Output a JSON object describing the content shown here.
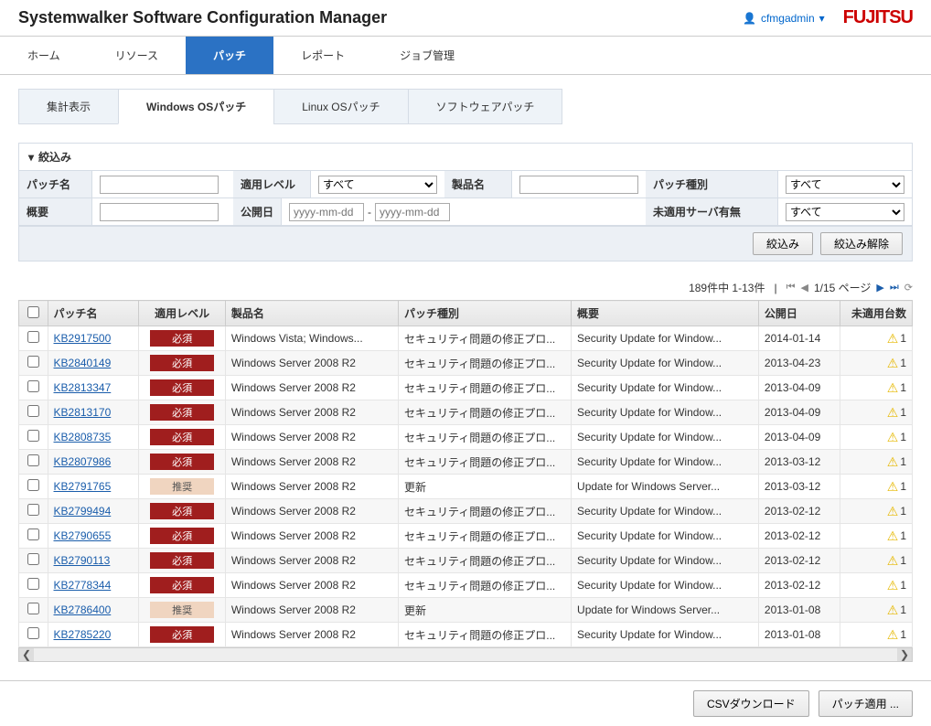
{
  "header": {
    "title": "Systemwalker Software Configuration Manager",
    "username": "cfmgadmin",
    "logo": "FUJITSU"
  },
  "main_nav": {
    "items": [
      "ホーム",
      "リソース",
      "パッチ",
      "レポート",
      "ジョブ管理"
    ],
    "active": 2
  },
  "sub_tabs": {
    "items": [
      "集計表示",
      "Windows OSパッチ",
      "Linux OSパッチ",
      "ソフトウェアパッチ"
    ],
    "active": 1
  },
  "filter": {
    "title": "絞込み",
    "labels": {
      "patch_name": "パッチ名",
      "apply_level": "適用レベル",
      "product_name": "製品名",
      "patch_type": "パッチ種別",
      "summary": "概要",
      "publish_date": "公開日",
      "unapplied_server": "未適用サーバ有無"
    },
    "placeholders": {
      "date": "yyyy-mm-dd"
    },
    "select_all": "すべて",
    "date_sep": "-",
    "actions": {
      "filter": "絞込み",
      "clear": "絞込み解除"
    }
  },
  "pagination": {
    "count_text": "189件中 1-13件",
    "page_text": "1/15 ページ"
  },
  "table": {
    "headers": {
      "name": "パッチ名",
      "level": "適用レベル",
      "product": "製品名",
      "type": "パッチ種別",
      "summary": "概要",
      "date": "公開日",
      "unapplied": "未適用台数"
    },
    "level_labels": {
      "required": "必須",
      "recommended": "推奨"
    },
    "rows": [
      {
        "name": "KB2917500",
        "level": "required",
        "product": "Windows Vista; Windows...",
        "type": "セキュリティ問題の修正プロ...",
        "summary": "Security Update for Window...",
        "date": "2014-01-14",
        "unapplied": "1"
      },
      {
        "name": "KB2840149",
        "level": "required",
        "product": "Windows Server 2008 R2",
        "type": "セキュリティ問題の修正プロ...",
        "summary": "Security Update for Window...",
        "date": "2013-04-23",
        "unapplied": "1"
      },
      {
        "name": "KB2813347",
        "level": "required",
        "product": "Windows Server 2008 R2",
        "type": "セキュリティ問題の修正プロ...",
        "summary": "Security Update for Window...",
        "date": "2013-04-09",
        "unapplied": "1"
      },
      {
        "name": "KB2813170",
        "level": "required",
        "product": "Windows Server 2008 R2",
        "type": "セキュリティ問題の修正プロ...",
        "summary": "Security Update for Window...",
        "date": "2013-04-09",
        "unapplied": "1"
      },
      {
        "name": "KB2808735",
        "level": "required",
        "product": "Windows Server 2008 R2",
        "type": "セキュリティ問題の修正プロ...",
        "summary": "Security Update for Window...",
        "date": "2013-04-09",
        "unapplied": "1"
      },
      {
        "name": "KB2807986",
        "level": "required",
        "product": "Windows Server 2008 R2",
        "type": "セキュリティ問題の修正プロ...",
        "summary": "Security Update for Window...",
        "date": "2013-03-12",
        "unapplied": "1"
      },
      {
        "name": "KB2791765",
        "level": "recommended",
        "product": "Windows Server 2008 R2",
        "type": "更新",
        "summary": "Update for Windows Server...",
        "date": "2013-03-12",
        "unapplied": "1"
      },
      {
        "name": "KB2799494",
        "level": "required",
        "product": "Windows Server 2008 R2",
        "type": "セキュリティ問題の修正プロ...",
        "summary": "Security Update for Window...",
        "date": "2013-02-12",
        "unapplied": "1"
      },
      {
        "name": "KB2790655",
        "level": "required",
        "product": "Windows Server 2008 R2",
        "type": "セキュリティ問題の修正プロ...",
        "summary": "Security Update for Window...",
        "date": "2013-02-12",
        "unapplied": "1"
      },
      {
        "name": "KB2790113",
        "level": "required",
        "product": "Windows Server 2008 R2",
        "type": "セキュリティ問題の修正プロ...",
        "summary": "Security Update for Window...",
        "date": "2013-02-12",
        "unapplied": "1"
      },
      {
        "name": "KB2778344",
        "level": "required",
        "product": "Windows Server 2008 R2",
        "type": "セキュリティ問題の修正プロ...",
        "summary": "Security Update for Window...",
        "date": "2013-02-12",
        "unapplied": "1"
      },
      {
        "name": "KB2786400",
        "level": "recommended",
        "product": "Windows Server 2008 R2",
        "type": "更新",
        "summary": "Update for Windows Server...",
        "date": "2013-01-08",
        "unapplied": "1"
      },
      {
        "name": "KB2785220",
        "level": "required",
        "product": "Windows Server 2008 R2",
        "type": "セキュリティ問題の修正プロ...",
        "summary": "Security Update for Window...",
        "date": "2013-01-08",
        "unapplied": "1"
      }
    ]
  },
  "footer": {
    "csv": "CSVダウンロード",
    "apply": "パッチ適用 ..."
  }
}
